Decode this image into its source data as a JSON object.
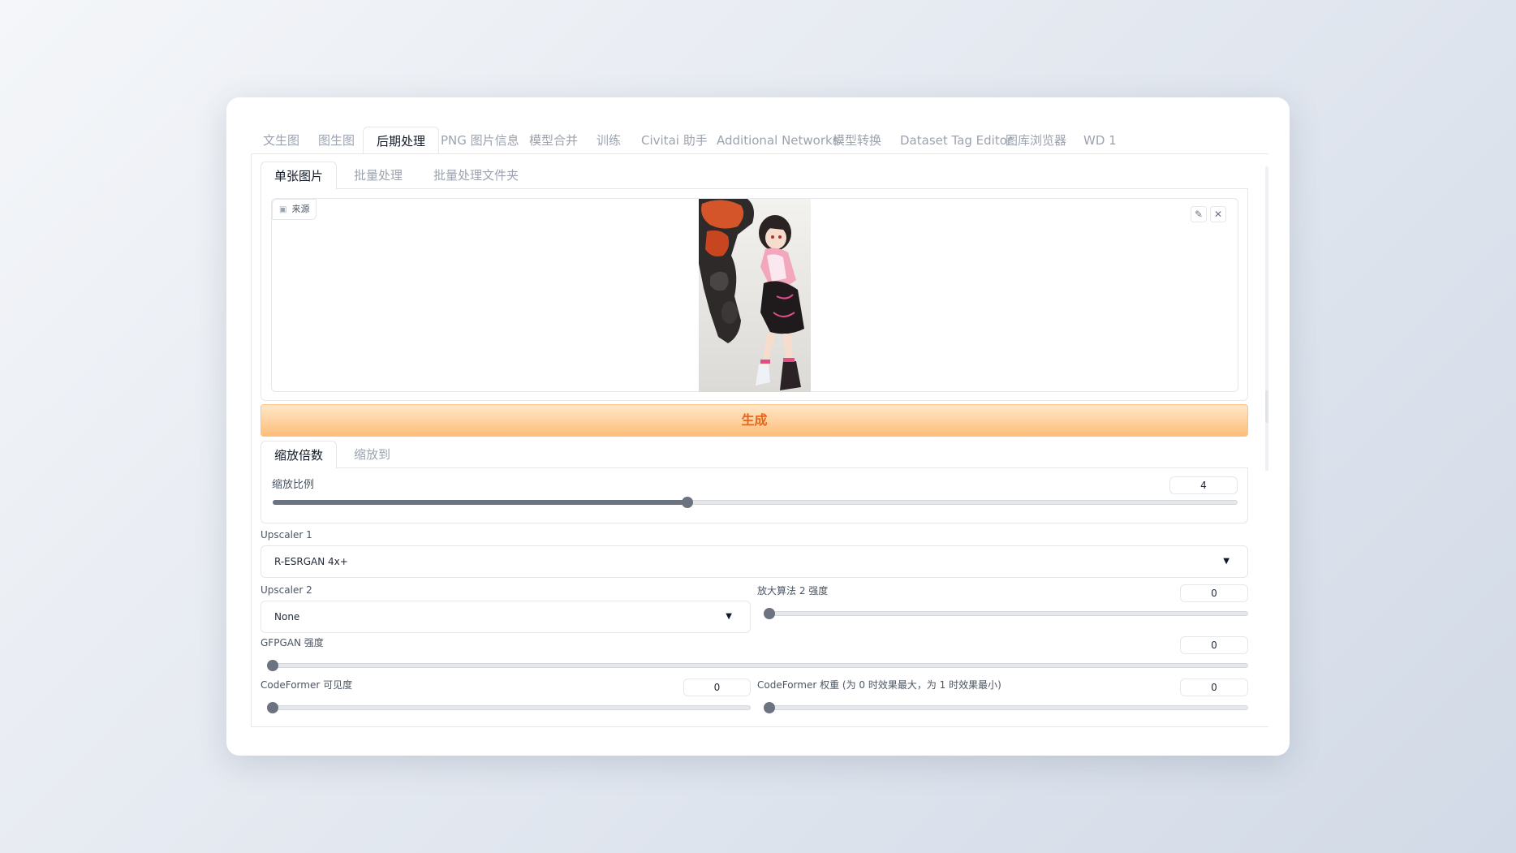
{
  "top_tabs": [
    {
      "label": "文生图",
      "active": false
    },
    {
      "label": "图生图",
      "active": false
    },
    {
      "label": "后期处理",
      "active": true
    },
    {
      "label": "PNG 图片信息",
      "active": false
    },
    {
      "label": "模型合并",
      "active": false
    },
    {
      "label": "训练",
      "active": false
    },
    {
      "label": "Civitai 助手",
      "active": false
    },
    {
      "label": "Additional Networks",
      "active": false
    },
    {
      "label": "模型转换",
      "active": false
    },
    {
      "label": "Dataset Tag Editor",
      "active": false
    },
    {
      "label": "图库浏览器",
      "active": false
    },
    {
      "label": "WD 1",
      "active": false
    }
  ],
  "sub_tabs": [
    {
      "label": "单张图片",
      "active": true
    },
    {
      "label": "批量处理",
      "active": false
    },
    {
      "label": "批量处理文件夹",
      "active": false
    }
  ],
  "image_panel": {
    "source_label": "来源",
    "icons": [
      "image-icon",
      "edit-icon",
      "close-icon"
    ]
  },
  "generate_label": "生成",
  "scale_tabs": [
    {
      "label": "缩放倍数",
      "active": true
    },
    {
      "label": "缩放到",
      "active": false
    }
  ],
  "scale": {
    "label": "缩放比例",
    "value": "4",
    "fraction": 0.43
  },
  "upscaler1": {
    "label": "Upscaler 1",
    "value": "R-ESRGAN 4x+"
  },
  "upscaler2": {
    "label": "Upscaler 2",
    "value": "None"
  },
  "upscaler2_strength": {
    "label": "放大算法 2 强度",
    "value": "0",
    "fraction": 0
  },
  "gfpgan": {
    "label": "GFPGAN 强度",
    "value": "0",
    "fraction": 0
  },
  "codeformer_visibility": {
    "label": "CodeFormer 可见度",
    "value": "0",
    "fraction": 0
  },
  "codeformer_weight": {
    "label": "CodeFormer 权重 (为 0 时效果最大，为 1 时效果最小)",
    "value": "0",
    "fraction": 0
  },
  "colors": {
    "accent": "#e8651a",
    "button_bg": "#fdbe7a",
    "slider": "#6b7280"
  }
}
